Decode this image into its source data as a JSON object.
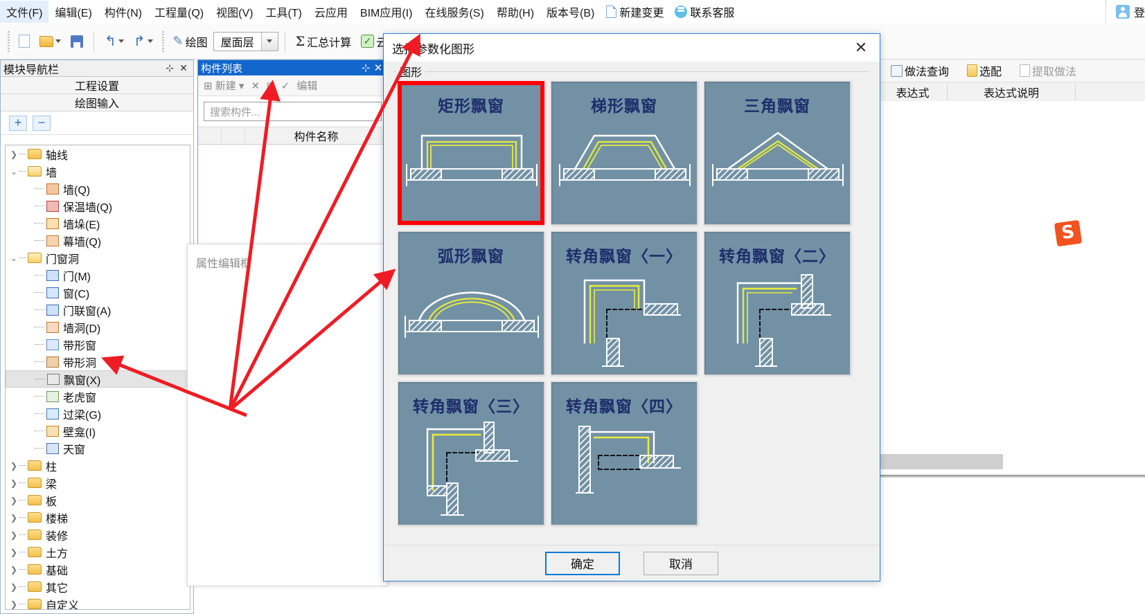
{
  "menubar": {
    "items": [
      {
        "label": "文件(F)"
      },
      {
        "label": "编辑(E)"
      },
      {
        "label": "构件(N)"
      },
      {
        "label": "工程量(Q)"
      },
      {
        "label": "视图(V)"
      },
      {
        "label": "工具(T)"
      },
      {
        "label": "云应用"
      },
      {
        "label": "BIM应用(I)"
      },
      {
        "label": "在线服务(S)"
      },
      {
        "label": "帮助(H)"
      },
      {
        "label": "版本号(B)"
      }
    ],
    "new_change": "新建变更",
    "contact_service": "联系客服",
    "login": "登",
    "icons": {
      "new_change": "new-document-icon",
      "contact": "headset-chat-icon",
      "login": "user-avatar-icon"
    }
  },
  "toolbar": {
    "new_doc": "",
    "open": "",
    "save": "",
    "undo": "↰",
    "redo": "↱",
    "draw": "绘图",
    "floor_value": "屋面层",
    "sigma": "Σ",
    "summary": "汇总计算",
    "cloud": "云"
  },
  "nav_panel": {
    "title": "模块导航栏",
    "pin": "⊹",
    "close": "✕",
    "tabs": [
      "工程设置",
      "绘图输入"
    ],
    "expand_label": "+",
    "collapse_label": "−",
    "tree": [
      {
        "label": "轴线",
        "type": "folder",
        "expanded": false,
        "level": 0
      },
      {
        "label": "墙",
        "type": "folder",
        "expanded": true,
        "level": 0
      },
      {
        "label": "墙(Q)",
        "type": "leaf",
        "level": 1,
        "icon": "brick-wall-icon"
      },
      {
        "label": "保温墙(Q)",
        "type": "leaf",
        "level": 1,
        "icon": "insulated-wall-icon"
      },
      {
        "label": "墙垛(E)",
        "type": "leaf",
        "level": 1,
        "icon": "wall-pier-icon"
      },
      {
        "label": "幕墙(Q)",
        "type": "leaf",
        "level": 1,
        "icon": "curtain-wall-icon"
      },
      {
        "label": "门窗洞",
        "type": "folder",
        "expanded": true,
        "level": 0
      },
      {
        "label": "门(M)",
        "type": "leaf",
        "level": 1,
        "icon": "door-icon"
      },
      {
        "label": "窗(C)",
        "type": "leaf",
        "level": 1,
        "icon": "window-icon"
      },
      {
        "label": "门联窗(A)",
        "type": "leaf",
        "level": 1,
        "icon": "door-window-icon"
      },
      {
        "label": "墙洞(D)",
        "type": "leaf",
        "level": 1,
        "icon": "wall-opening-icon"
      },
      {
        "label": "带形窗",
        "type": "leaf",
        "level": 1,
        "icon": "ribbon-window-icon"
      },
      {
        "label": "带形洞",
        "type": "leaf",
        "level": 1,
        "icon": "ribbon-opening-icon"
      },
      {
        "label": "飘窗(X)",
        "type": "leaf",
        "level": 1,
        "icon": "bay-window-icon",
        "selected": true
      },
      {
        "label": "老虎窗",
        "type": "leaf",
        "level": 1,
        "icon": "dormer-icon"
      },
      {
        "label": "过梁(G)",
        "type": "leaf",
        "level": 1,
        "icon": "lintel-icon"
      },
      {
        "label": "壁龛(I)",
        "type": "leaf",
        "level": 1,
        "icon": "niche-icon"
      },
      {
        "label": "天窗",
        "type": "leaf",
        "level": 1,
        "icon": "skylight-icon"
      },
      {
        "label": "柱",
        "type": "folder",
        "expanded": false,
        "level": 0
      },
      {
        "label": "梁",
        "type": "folder",
        "expanded": false,
        "level": 0
      },
      {
        "label": "板",
        "type": "folder",
        "expanded": false,
        "level": 0
      },
      {
        "label": "楼梯",
        "type": "folder",
        "expanded": false,
        "level": 0
      },
      {
        "label": "装修",
        "type": "folder",
        "expanded": false,
        "level": 0
      },
      {
        "label": "土方",
        "type": "folder",
        "expanded": false,
        "level": 0
      },
      {
        "label": "基础",
        "type": "folder",
        "expanded": false,
        "level": 0
      },
      {
        "label": "其它",
        "type": "folder",
        "expanded": false,
        "level": 0
      },
      {
        "label": "自定义",
        "type": "folder",
        "expanded": false,
        "level": 0
      }
    ]
  },
  "component_list": {
    "title": "构件列表",
    "pin": "⊹",
    "close": "✕",
    "tools": [
      "新建",
      "✕",
      "",
      "",
      "编辑"
    ],
    "new_label": "新建",
    "edit_label": "编辑",
    "search_placeholder": "搜索构件...",
    "column_name": "构件名称"
  },
  "property_box": {
    "placeholder": "属性编辑框"
  },
  "right_panel": {
    "tools": [
      "做法查询",
      "选配",
      "提取做法"
    ],
    "columns": [
      "表达式",
      "表达式说明"
    ]
  },
  "dialog": {
    "title": "选择参数化图形",
    "close": "✕",
    "group_label": "图形",
    "ok": "确定",
    "cancel": "取消",
    "selected_index": 0,
    "tiles": [
      {
        "label": "矩形飘窗",
        "shape": "rect-bay"
      },
      {
        "label": "梯形飘窗",
        "shape": "trapezoid-bay"
      },
      {
        "label": "三角飘窗",
        "shape": "triangle-bay"
      },
      {
        "label": "弧形飘窗",
        "shape": "arc-bay"
      },
      {
        "label": "转角飘窗〈一〉",
        "shape": "corner-bay-1"
      },
      {
        "label": "转角飘窗〈二〉",
        "shape": "corner-bay-2"
      },
      {
        "label": "转角飘窗〈三〉",
        "shape": "corner-bay-3"
      },
      {
        "label": "转角飘窗〈四〉",
        "shape": "corner-bay-4"
      }
    ]
  },
  "colors": {
    "tile_bg": "#7291a5",
    "tile_label": "#1d2d6b",
    "selection_red": "#ff0000",
    "accent_blue": "#1266cc",
    "yellow_line": "#e8ec3a"
  },
  "sogou_logo": "S"
}
